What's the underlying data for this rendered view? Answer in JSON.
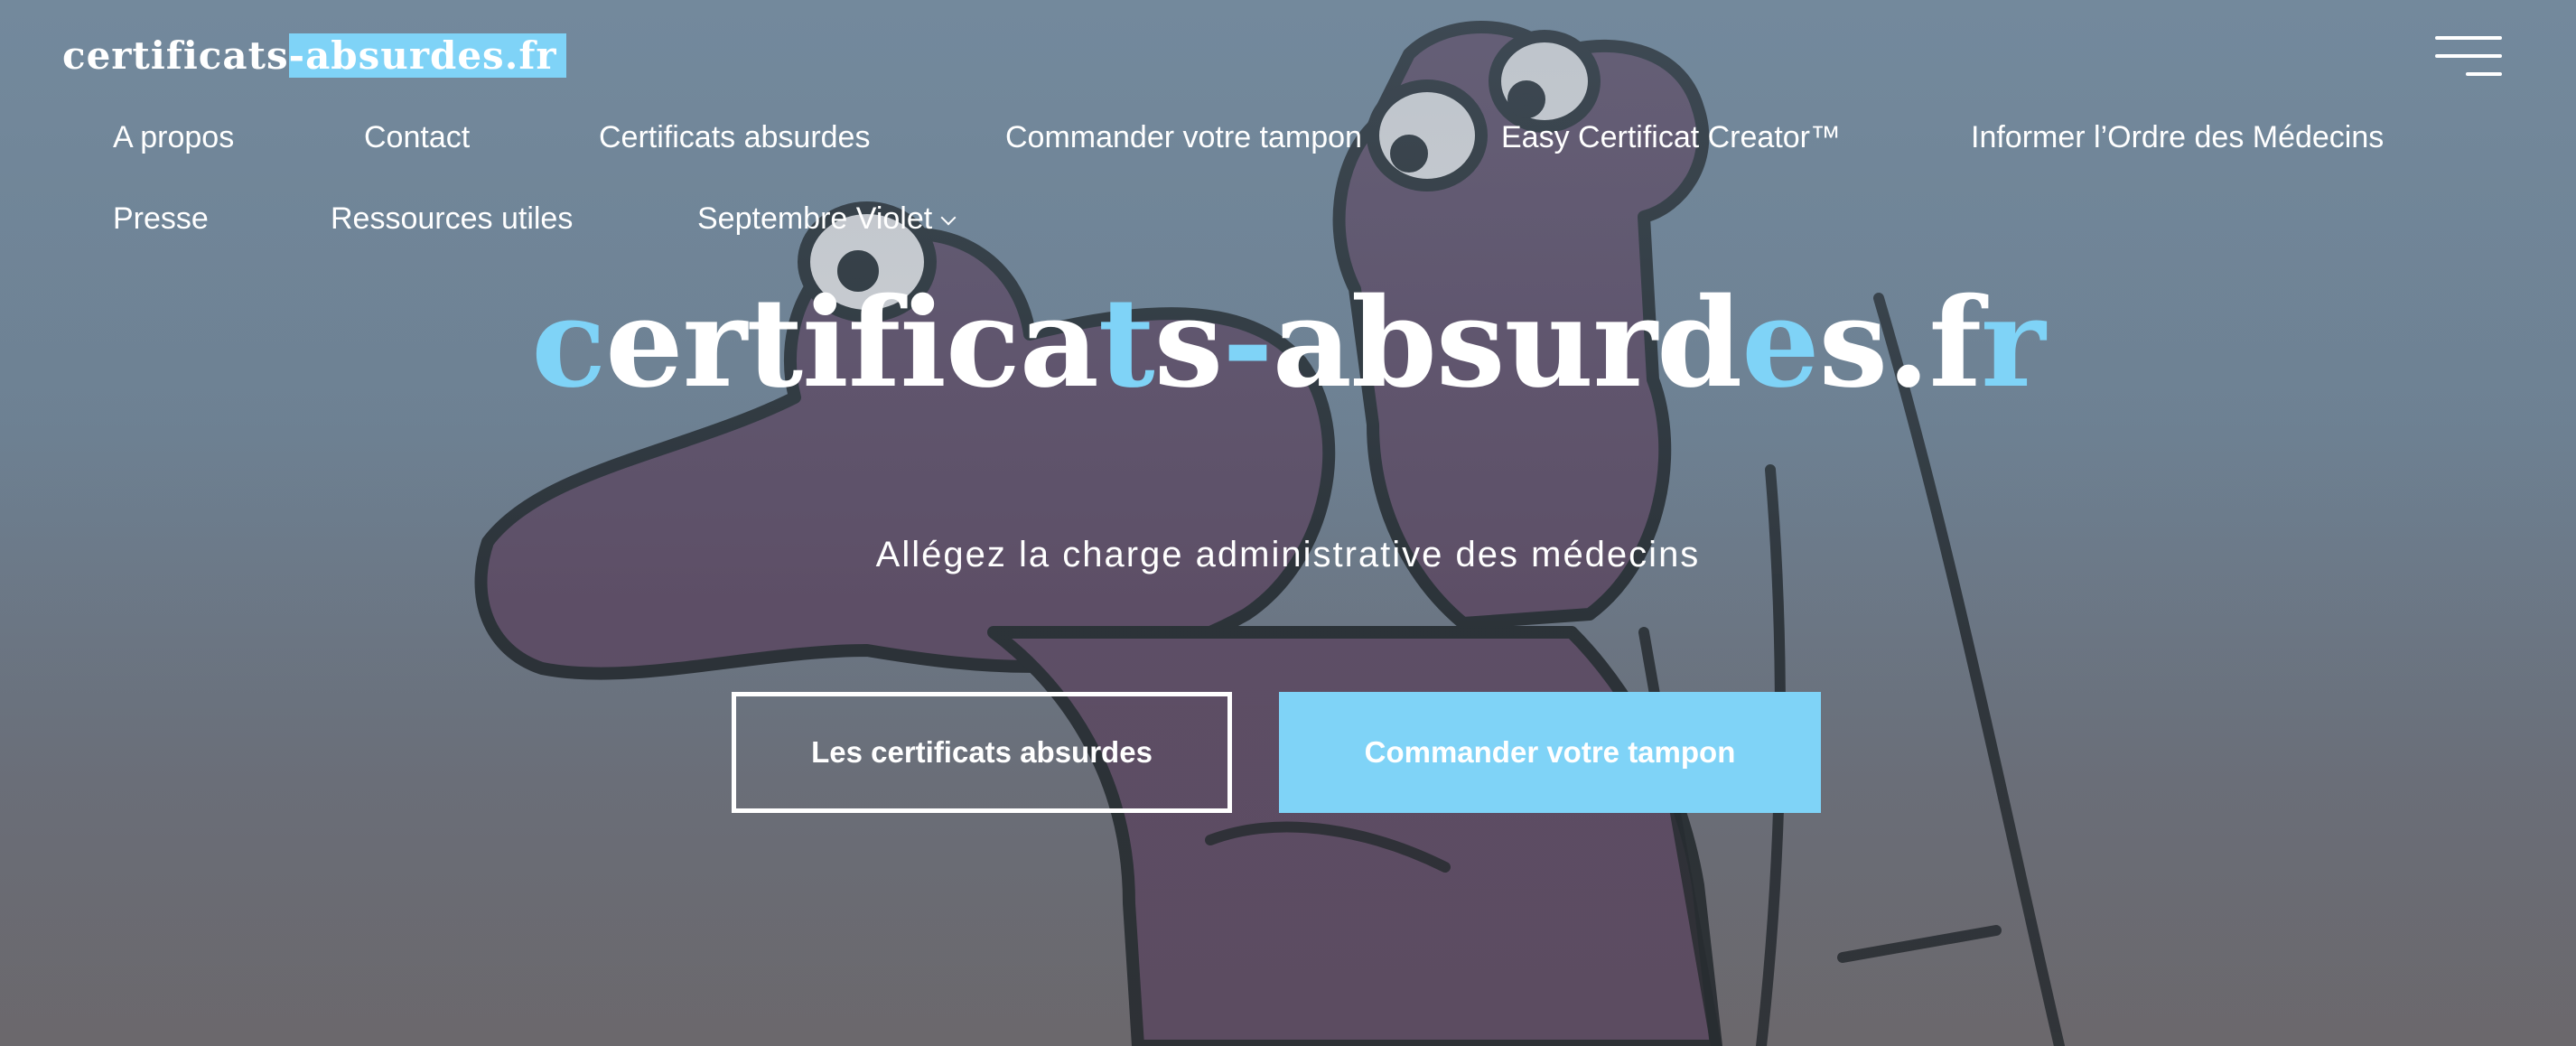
{
  "site": {
    "logo_text_main": "certificats",
    "logo_text_highlight": "-absurdes.fr"
  },
  "nav": {
    "items": [
      {
        "label": "A propos"
      },
      {
        "label": "Contact"
      },
      {
        "label": "Certificats absurdes"
      },
      {
        "label": "Commander votre tampon"
      },
      {
        "label": "Easy Certificat Creator™"
      },
      {
        "label": "Informer l’Ordre des Médecins"
      },
      {
        "label": "Presse"
      },
      {
        "label": "Ressources utiles"
      },
      {
        "label": "Septembre Violet"
      }
    ]
  },
  "hero": {
    "title_parts": [
      "c",
      "ertifica",
      "t",
      "s",
      "-",
      "absurd",
      "e",
      "s.f",
      "r"
    ],
    "subtitle": "Allégez la charge administrative des médecins",
    "cta_primary": "Les certificats absurdes",
    "cta_secondary": "Commander votre tampon"
  },
  "colors": {
    "accent": "#7fd3f7",
    "text": "#ffffff",
    "background_top": "#72889b",
    "background_bottom": "#6d6a6e"
  },
  "icons": {
    "menu": "hamburger-icon",
    "dropdown": "chevron-down-icon"
  }
}
